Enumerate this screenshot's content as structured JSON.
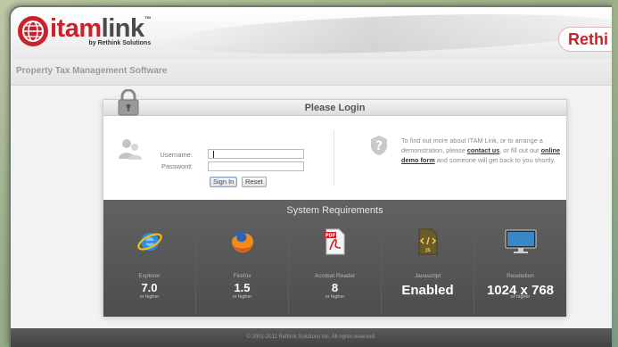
{
  "header": {
    "logo_name_part1": "itam",
    "logo_name_part2": "link",
    "logo_trademark": "™",
    "logo_sub": "by Rethink Solutions",
    "rethink_tab": "Rethi",
    "tagline": "Property Tax Management Software"
  },
  "login": {
    "title": "Please Login",
    "username_label": "Username:",
    "password_label": "Password:",
    "username_value": "",
    "password_value": "",
    "signin_label": "Sign In",
    "reset_label": "Reset",
    "info_prefix": "To find out more about ITAM Link, or to arrange a demonstration, please ",
    "contact_link": "contact us",
    "info_middle": ", or fill out our ",
    "demo_link": "online demo form",
    "info_suffix": " and someone will get back to you shortly."
  },
  "requirements": {
    "title": "System Requirements",
    "items": [
      {
        "icon": "internet-explorer-icon",
        "name": "Explorer",
        "value": "7.0",
        "note": "or higher"
      },
      {
        "icon": "firefox-icon",
        "name": "Firefox",
        "value": "1.5",
        "note": "or higher"
      },
      {
        "icon": "acrobat-reader-icon",
        "name": "Acrobat Reader",
        "value": "8",
        "note": "or higher"
      },
      {
        "icon": "javascript-icon",
        "name": "Javascript",
        "value": "Enabled",
        "note": ""
      },
      {
        "icon": "monitor-icon",
        "name": "Resolution",
        "value": "1024 x 768",
        "note": "or higher"
      }
    ]
  },
  "footer": {
    "copyright": "© 2001-2011 Rethink Solutions Inc. All rights reserved."
  },
  "colors": {
    "brand_red": "#c8232c",
    "panel_dark": "#555555"
  }
}
